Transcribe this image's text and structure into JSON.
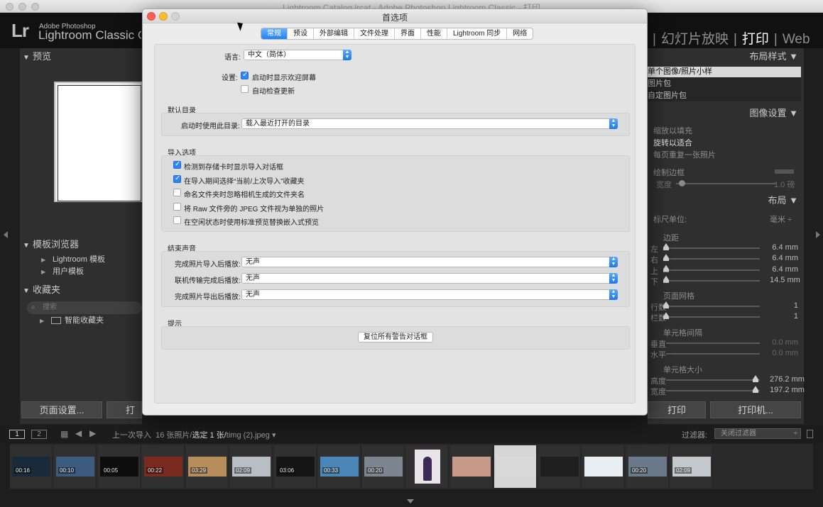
{
  "window": {
    "title": "Lightroom Catalog.lrcat - Adobe Photoshop Lightroom Classic - 打印"
  },
  "app": {
    "logo": "Lr",
    "brand_small": "Adobe Photoshop",
    "brand_large": "Lightroom Classic CC"
  },
  "modules": [
    {
      "label": "幻灯片放映"
    },
    {
      "label": "打印"
    },
    {
      "label": "Web"
    }
  ],
  "left_panel": {
    "preview_title": "预览",
    "template_browser_title": "模板浏览器",
    "templates": [
      "Lightroom 模板",
      "用户模板"
    ],
    "collections_title": "收藏夹",
    "collections_search_placeholder": "搜索",
    "collections": [
      "智能收藏夹"
    ],
    "page_setup_button": "页面设置...",
    "print_settings_button": "打印"
  },
  "right_panel": {
    "layout_style_title": "布局样式",
    "layout_options": [
      "单个图像/照片小样",
      "图片包",
      "自定图片包"
    ],
    "image_settings_title": "图像设置",
    "image_options": [
      "缩放以填充",
      "旋转以适合",
      "每页重复一张照片"
    ],
    "draw_border": "绘制边框",
    "border_width_label": "宽度",
    "border_width_value": "1.0 磅",
    "layout_title": "布局",
    "ruler_units_label": "标尺单位:",
    "ruler_units_value": "毫米 ÷",
    "margins_title": "边距",
    "margins": [
      {
        "label": "左",
        "value": "6.4 mm",
        "frac": 0.0
      },
      {
        "label": "右",
        "value": "6.4 mm",
        "frac": 0.0
      },
      {
        "label": "上",
        "value": "6.4 mm",
        "frac": 0.0
      },
      {
        "label": "下",
        "value": "14.5 mm",
        "frac": 0.0
      }
    ],
    "page_grid_title": "页面网格",
    "page_grid": [
      {
        "label": "行数",
        "value": "1"
      },
      {
        "label": "栏数",
        "value": "1"
      }
    ],
    "cell_spacing_title": "单元格间隔",
    "cell_spacing": [
      {
        "label": "垂直",
        "value": "0.0 mm"
      },
      {
        "label": "水平",
        "value": "0.0 mm"
      }
    ],
    "cell_size_title": "单元格大小",
    "cell_size": [
      {
        "label": "高度",
        "value": "276.2 mm"
      },
      {
        "label": "宽度",
        "value": "197.2 mm"
      }
    ],
    "print_button": "打印",
    "printer_button": "打印机..."
  },
  "film_bar": {
    "page1": "1",
    "page2": "2",
    "source": "上一次导入",
    "count": "16 张照片/",
    "selected": "选定 1 张/",
    "filename": "timg (2).jpeg",
    "filter_label": "过滤器:",
    "filter_value": "关闭过滤器"
  },
  "filmstrip": [
    {
      "badge": "00:16",
      "color": "#1b2a3a"
    },
    {
      "badge": "00:10",
      "color": "#3c5b7e"
    },
    {
      "badge": "00:05",
      "color": "#0d0d0d"
    },
    {
      "badge": "00:22",
      "color": "#7b2a20"
    },
    {
      "badge": "03:29",
      "color": "#b68d5b"
    },
    {
      "badge": "02:09",
      "color": "#b9bec4"
    },
    {
      "badge": "03:06",
      "color": "#151515"
    },
    {
      "badge": "00:33",
      "color": "#4a86b7"
    },
    {
      "badge": "00:20",
      "color": "#7d8690"
    },
    {
      "badge": "",
      "color": "#e8e4e8"
    },
    {
      "badge": "",
      "color": "#c79a8a"
    },
    {
      "badge": "",
      "color": "#d9d9d9"
    },
    {
      "badge": "",
      "color": "#1f1f1f"
    },
    {
      "badge": "",
      "color": "#e9eef3"
    },
    {
      "badge": "00:20",
      "color": "#6a7a8a"
    },
    {
      "badge": "02:09",
      "color": "#c4c8cc"
    }
  ],
  "dialog": {
    "title": "首选项",
    "tabs": [
      "常规",
      "预设",
      "外部编辑",
      "文件处理",
      "界面",
      "性能",
      "Lightroom 同步",
      "网络"
    ],
    "active_tab": "常规",
    "language_label": "语言:",
    "language_value": "中文（简体）",
    "settings_label": "设置:",
    "show_splash": "启动时显示欢迎屏幕",
    "check_updates": "自动检查更新",
    "default_catalog_title": "默认目录",
    "startup_catalog_label": "启动时使用此目录:",
    "startup_catalog_value": "载入最近打开的目录",
    "import_options_title": "导入选项",
    "import_options": [
      {
        "label": "检测到存储卡时显示导入对话框",
        "checked": true
      },
      {
        "label": "在导入期间选择“当前/上次导入”收藏夹",
        "checked": true
      },
      {
        "label": "命名文件夹时忽略相机生成的文件夹名",
        "checked": false
      },
      {
        "label": "将 Raw 文件旁的 JPEG 文件视为单独的照片",
        "checked": false
      },
      {
        "label": "在空闲状态时使用标准预览替换嵌入式预览",
        "checked": false
      }
    ],
    "completion_sounds_title": "结束声音",
    "sounds": [
      {
        "label": "完成照片导入后播放:",
        "value": "无声"
      },
      {
        "label": "联机传输完成后播放:",
        "value": "无声"
      },
      {
        "label": "完成照片导出后播放:",
        "value": "无声"
      }
    ],
    "prompts_title": "提示",
    "reset_warnings_button": "复位所有警告对话框"
  }
}
